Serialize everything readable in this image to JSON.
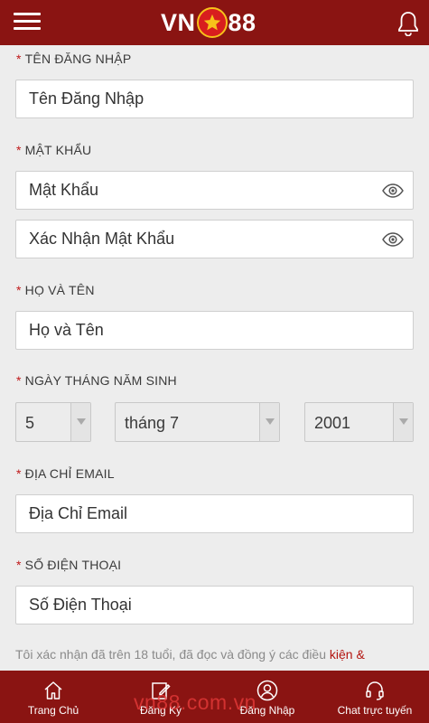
{
  "header": {
    "logo_left": "VN",
    "logo_right": "88",
    "star_glyph": "★"
  },
  "form": {
    "username": {
      "label": "TÊN ĐĂNG NHẬP",
      "placeholder": "Tên Đăng Nhập"
    },
    "password": {
      "label": "MẬT KHẨU",
      "placeholder": "Mật Khẩu",
      "confirm_placeholder": "Xác Nhận Mật Khẩu"
    },
    "fullname": {
      "label": "HỌ VÀ TÊN",
      "placeholder": "Họ và Tên"
    },
    "birthday": {
      "label": "NGÀY THÁNG NĂM SINH",
      "day": "5",
      "month": "tháng 7",
      "year": "2001"
    },
    "email": {
      "label": "ĐỊA CHỈ EMAIL",
      "placeholder": "Địa Chỉ Email"
    },
    "phone": {
      "label": "SỐ ĐIỆN THOẠI",
      "placeholder": "Số Điện Thoại"
    },
    "required_mark": "*"
  },
  "terms": {
    "text": "Tôi xác nhận đã trên 18 tuổi, đã đọc và đồng ý các điều ",
    "link": "kiện &"
  },
  "bottom_nav": [
    {
      "label": "Trang Chủ",
      "icon": "home-icon"
    },
    {
      "label": "Đăng Ký",
      "icon": "edit-icon"
    },
    {
      "label": "Đăng Nhập",
      "icon": "user-icon"
    },
    {
      "label": "Chat trực tuyến",
      "icon": "headset-icon"
    }
  ],
  "watermark": "vn88.com.vn",
  "colors": {
    "brand": "#8a1412",
    "required": "#c0191a",
    "link": "#b3140f",
    "background": "#ededed"
  }
}
